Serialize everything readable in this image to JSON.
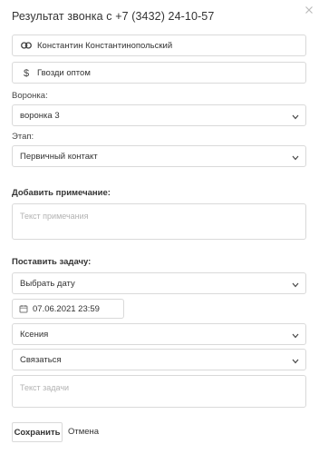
{
  "dialog": {
    "title": "Результат звонка с +7 (3432) 24-10-57"
  },
  "contact": {
    "icon": "link-icon",
    "value": "Константин Константинопольский"
  },
  "deal": {
    "icon": "dollar-icon",
    "value": "Гвозди оптом"
  },
  "funnel": {
    "label": "Воронка:",
    "selected": "воронка 3"
  },
  "stage": {
    "label": "Этап:",
    "selected": "Первичный контакт"
  },
  "note": {
    "label": "Добавить примечание:",
    "placeholder": "Текст примечания"
  },
  "task": {
    "label": "Поставить задачу:",
    "date_select": "Выбрать дату",
    "datetime": "07.06.2021 23:59",
    "assignee": "Ксения",
    "type": "Связаться",
    "placeholder": "Текст задачи"
  },
  "actions": {
    "save": "Сохранить",
    "cancel": "Отмена"
  }
}
